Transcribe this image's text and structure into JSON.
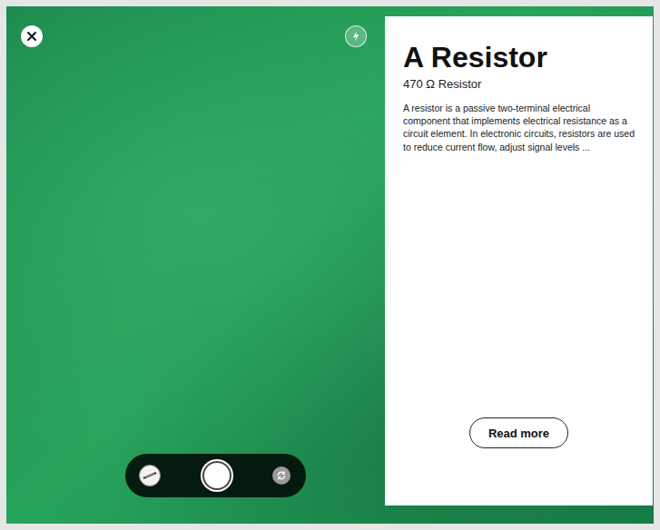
{
  "panel": {
    "title": "A Resistor",
    "subtitle": "470 Ω Resistor",
    "description": "A resistor is a passive two-terminal electrical component that implements electrical resistance as a circuit element. In electronic circuits, resistors are used to reduce current flow, adjust signal levels ...",
    "button": "Read more"
  }
}
